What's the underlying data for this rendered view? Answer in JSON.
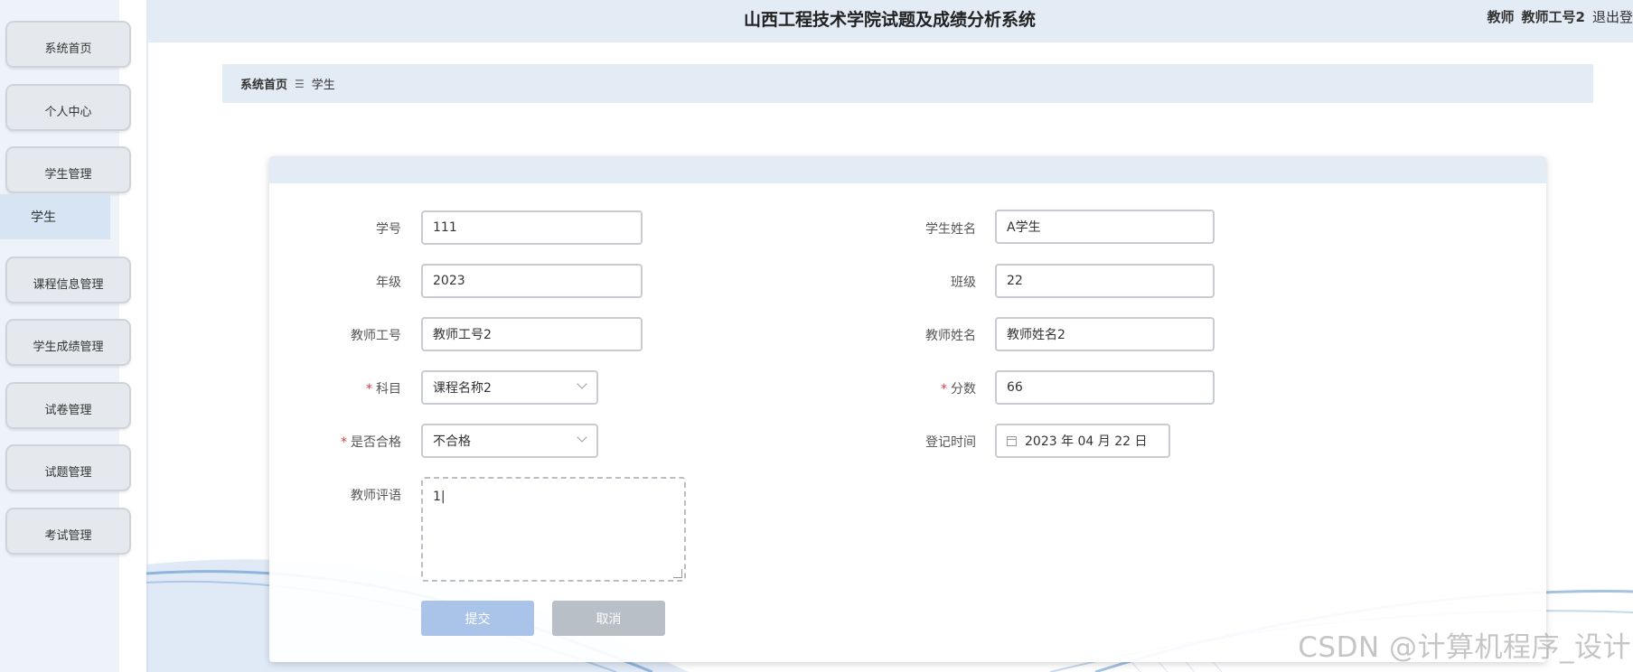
{
  "header": {
    "title": "山西工程技术学院试题及成绩分析系统",
    "role": "教师",
    "user": "教师工号2",
    "logout": "退出登"
  },
  "sidebar": {
    "items": [
      {
        "label": "系统首页"
      },
      {
        "label": "个人中心"
      },
      {
        "label": "学生管理"
      },
      {
        "label": "课程信息管理"
      },
      {
        "label": "学生成绩管理"
      },
      {
        "label": "试卷管理"
      },
      {
        "label": "试题管理"
      },
      {
        "label": "考试管理"
      }
    ],
    "submenu": {
      "label": "学生"
    }
  },
  "breadcrumb": {
    "home": "系统首页",
    "separator": "☰",
    "current": "学生"
  },
  "form": {
    "student_id": {
      "label": "学号",
      "value": "111"
    },
    "student_name": {
      "label": "学生姓名",
      "value": "A学生"
    },
    "grade": {
      "label": "年级",
      "value": "2023"
    },
    "class": {
      "label": "班级",
      "value": "22"
    },
    "teacher_id": {
      "label": "教师工号",
      "value": "教师工号2"
    },
    "teacher_name": {
      "label": "教师姓名",
      "value": "教师姓名2"
    },
    "subject": {
      "label": "科目",
      "value": "课程名称2",
      "required": true
    },
    "score": {
      "label": "分数",
      "value": "66",
      "required": true
    },
    "passed": {
      "label": "是否合格",
      "value": "不合格",
      "required": true
    },
    "register_time": {
      "label": "登记时间",
      "value": "2023 年 04 月 22 日"
    },
    "comment": {
      "label": "教师评语",
      "value": "1|"
    },
    "required_mark": "*",
    "submit_label": "提交",
    "cancel_label": "取消"
  },
  "watermark": "CSDN @计算机程序_设计",
  "colors": {
    "accent": "#a9c4e8",
    "header_bg": "#e3ebf5",
    "required": "#e04040"
  }
}
